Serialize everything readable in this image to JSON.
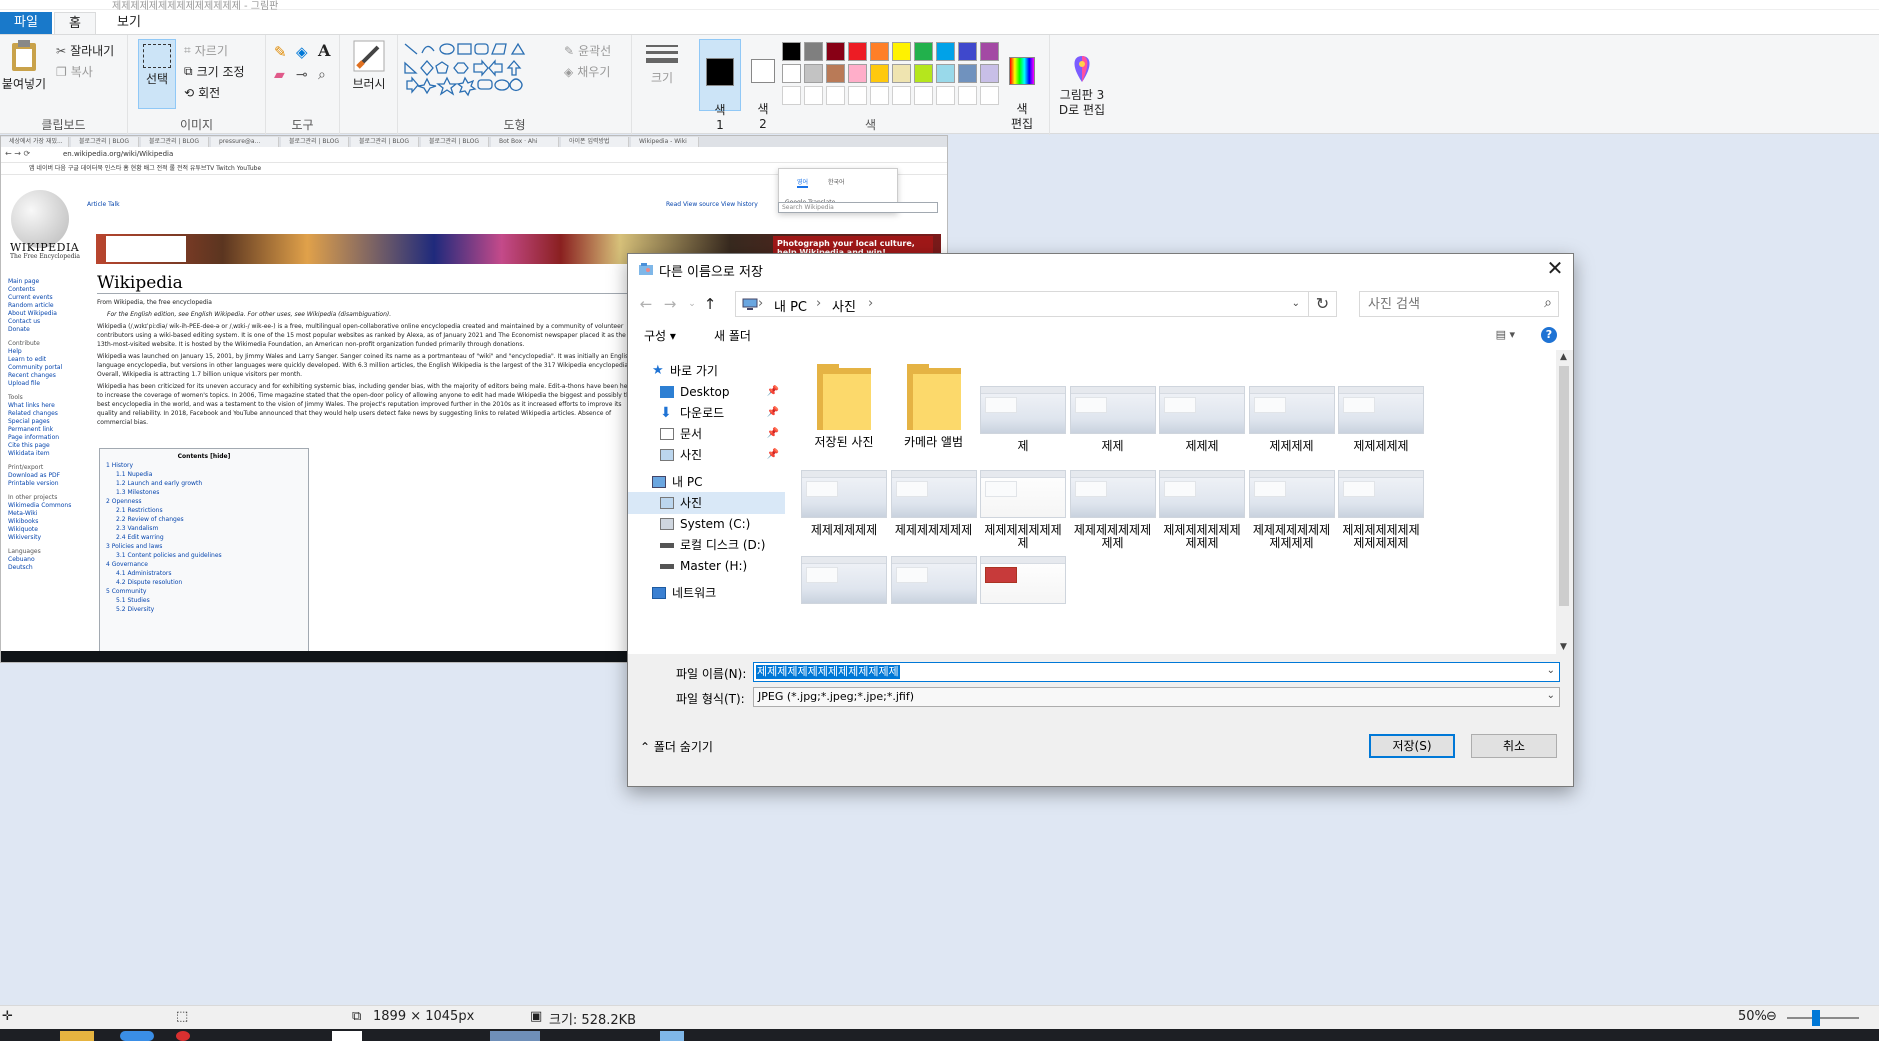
{
  "window": {
    "title": "제제제제제제제제제제제제제제 - 그림판"
  },
  "menu_tabs": {
    "file": "파일",
    "home": "홈",
    "view": "보기"
  },
  "ribbon": {
    "clipboard": {
      "paste": "붙여넣기",
      "cut": "잘라내기",
      "copy": "복사",
      "label": "클립보드"
    },
    "image": {
      "select": "선택",
      "crop": "자르기",
      "resize": "크기 조정",
      "rotate": "회전",
      "label": "이미지"
    },
    "tools": {
      "label": "도구"
    },
    "brush": {
      "label": "브러시"
    },
    "shapes": {
      "outline": "윤곽선",
      "fill": "채우기",
      "label": "도형"
    },
    "size": {
      "label": "크기"
    },
    "colors": {
      "color1": "색\n1",
      "color2": "색\n2",
      "edit": "색\n편집",
      "label": "색",
      "palette_row1": [
        "#000000",
        "#7f7f7f",
        "#880015",
        "#ed1c24",
        "#ff7f27",
        "#fff200",
        "#22b14c",
        "#00a2e8",
        "#3f48cc",
        "#a349a4"
      ],
      "palette_row2": [
        "#ffffff",
        "#c3c3c3",
        "#b97a57",
        "#ffaec9",
        "#ffc90e",
        "#efe4b0",
        "#b5e61d",
        "#99d9ea",
        "#7092be",
        "#c8bfe7"
      ]
    },
    "paint3d": "그림판 3\nD로 편집"
  },
  "screenshot": {
    "url": "en.wikipedia.org/wiki/Wikipedia",
    "tabs": [
      "세상에서 가장 재밌...",
      "블로그관리 | BLOG",
      "블로그관리 | BLOG",
      "pressure@a...",
      "블로그관리 | BLOG",
      "블로그관리 | BLOG",
      "블로그관리 | BLOG",
      "Bot Box · Ahi",
      "아이폰 입력방법",
      "Wikipedia - Wiki"
    ],
    "bookmarks": "앱  네이버  다음  구글  데이터북  인스타  홈 현황  배그 전적  롤 전적  유투브TV  Twitch  YouTube",
    "wordmark": "WIKIPEDIA",
    "sub": "The Free Encyclopedia",
    "heading": "Wikipedia",
    "from": "From Wikipedia, the free encyclopedia",
    "para1": "For the English edition, see English Wikipedia. For other uses, see Wikipedia (disambiguation).",
    "para2": "Wikipedia (/ˌwɪkɪˈpiːdiə/ wik-ih-PEE-dee-ə or /ˌwɪki-/ wik-ee-) is a free, multilingual open-collaborative online encyclopedia created and maintained by a community of volunteer contributors using a wiki-based editing system. It is one of the 15 most popular websites as ranked by Alexa, as of January 2021 and The Economist newspaper placed it as the 13th-most-visited website. It is hosted by the Wikimedia Foundation, an American non-profit organization funded primarily through donations.",
    "para3": "Wikipedia was launched on January 15, 2001, by Jimmy Wales and Larry Sanger. Sanger coined its name as a portmanteau of \"wiki\" and \"encyclopedia\". It was initially an English-language encyclopedia, but versions in other languages were quickly developed. With 6.3 million articles, the English Wikipedia is the largest of the 317 Wikipedia encyclopedias. Overall, Wikipedia is attracting 1.7 billion unique visitors per month.",
    "para4": "Wikipedia has been criticized for its uneven accuracy and for exhibiting systemic bias, including gender bias, with the majority of editors being male. Edit-a-thons have been held to increase the coverage of women's topics. In 2006, Time magazine stated that the open-door policy of allowing anyone to edit had made Wikipedia the biggest and possibly the best encyclopedia in the world, and was a testament to the vision of Jimmy Wales. The project's reputation improved further in the 2010s as it increased efforts to improve its quality and reliability. In 2018, Facebook and YouTube announced that they would help users detect fake news by suggesting links to related Wikipedia articles. Absence of commercial bias.",
    "toc_title": "Contents [hide]",
    "toc": [
      "1 History",
      "1.1 Nupedia",
      "1.2 Launch and early growth",
      "1.3 Milestones",
      "2 Openness",
      "2.1 Restrictions",
      "2.2 Review of changes",
      "2.3 Vandalism",
      "2.4 Edit warring",
      "3 Policies and laws",
      "3.1 Content policies and guidelines",
      "4 Governance",
      "4.1 Administrators",
      "4.2 Dispute resolution",
      "5 Community",
      "5.1 Studies",
      "5.2 Diversity"
    ],
    "sidebar": [
      "Main page",
      "Contents",
      "Current events",
      "Random article",
      "About Wikipedia",
      "Contact us",
      "Donate",
      "Contribute",
      "Help",
      "Learn to edit",
      "Community portal",
      "Recent changes",
      "Upload file",
      "Tools",
      "What links here",
      "Related changes",
      "Special pages",
      "Permanent link",
      "Page information",
      "Cite this page",
      "Wikidata item",
      "Print/export",
      "Download as PDF",
      "Printable version",
      "In other projects",
      "Wikimedia Commons",
      "Meta-Wiki",
      "Wikibooks",
      "Wikiquote",
      "Wikiversity",
      "Languages",
      "Cebuano",
      "Deutsch"
    ],
    "article_tabs": "Article   Talk",
    "read_tabs": "Read   View source   View history",
    "search_ph": "Search Wikipedia",
    "banner_ad": "Photograph your local culture, help Wikipedia and win!",
    "popup_tab1": "영어",
    "popup_tab2": "한국어",
    "popup_gt": "Google Translate"
  },
  "dialog": {
    "title": "다른 이름으로 저장",
    "breadcrumb": [
      "내 PC",
      "사진"
    ],
    "search_placeholder": "사진 검색",
    "organize": "구성 ▾",
    "new_folder": "새 폴더",
    "nav": {
      "quick_access": "바로 가기",
      "desktop": "Desktop",
      "downloads": "다운로드",
      "documents": "문서",
      "pictures": "사진",
      "this_pc": "내 PC",
      "pictures2": "사진",
      "system_c": "System (C:)",
      "local_d": "로컬 디스크 (D:)",
      "master_h": "Master (H:)",
      "network": "네트워크"
    },
    "files": [
      {
        "name": "저장된 사진",
        "kind": "folder"
      },
      {
        "name": "카메라 앨범",
        "kind": "folder"
      },
      {
        "name": "제",
        "kind": "image"
      },
      {
        "name": "제제",
        "kind": "image"
      },
      {
        "name": "제제제",
        "kind": "image"
      },
      {
        "name": "제제제제",
        "kind": "image"
      },
      {
        "name": "제제제제제",
        "kind": "image"
      },
      {
        "name": "제제제제제제",
        "kind": "image"
      },
      {
        "name": "제제제제제제제",
        "kind": "image"
      },
      {
        "name": "제제제제제제제제",
        "kind": "web"
      },
      {
        "name": "제제제제제제제제제",
        "kind": "image"
      },
      {
        "name": "제제제제제제제제제제",
        "kind": "image"
      },
      {
        "name": "제제제제제제제제제제제",
        "kind": "image"
      },
      {
        "name": "제제제제제제제제제제제제",
        "kind": "image"
      },
      {
        "name": "",
        "kind": "image"
      },
      {
        "name": "",
        "kind": "image"
      },
      {
        "name": "",
        "kind": "red"
      }
    ],
    "filename_label": "파일 이름(N):",
    "filename_value": "제제제제제제제제제제제제제제",
    "filetype_label": "파일 형식(T):",
    "filetype_value": "JPEG (*.jpg;*.jpeg;*.jpe;*.jfif)",
    "hide_folders": "폴더 숨기기",
    "save": "저장(S)",
    "cancel": "취소"
  },
  "statusbar": {
    "dimensions": "1899 × 1045px",
    "size": "크기: 528.2KB",
    "zoom": "50%"
  }
}
